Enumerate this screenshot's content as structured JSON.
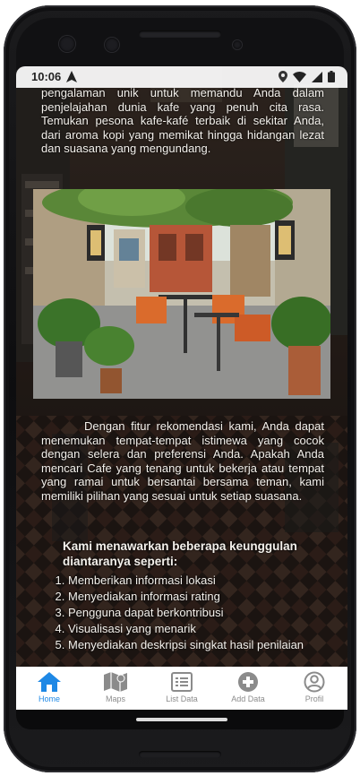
{
  "status_bar": {
    "time": "10:06"
  },
  "content": {
    "paragraph_1": "pengalaman unik untuk memandu Anda dalam penjelajahan dunia kafe yang penuh cita rasa. Temukan pesona kafe-kafé terbaik di sekitar Anda, dari aroma kopi yang memikat hingga hidangan lezat dan suasana yang mengundang.",
    "paragraph_2": "Dengan fitur rekomendasi kami, Anda dapat menemukan tempat-tempat istimewa yang cocok dengan selera dan preferensi Anda. Apakah Anda mencari Cafe yang tenang untuk bekerja atau tempat yang ramai untuk bersantai bersama teman, kami memiliki pilihan yang sesuai untuk setiap suasana.",
    "list_title": "Kami menawarkan beberapa keunggulan diantaranya seperti:",
    "list_items": [
      "Memberikan informasi lokasi",
      "Menyediakan informasi rating",
      "Pengguna dapat berkontribusi",
      "Visualisasi yang menarik",
      "Menyediakan deskripsi singkat hasil penilaian"
    ]
  },
  "nav": {
    "items": [
      {
        "label": "Home",
        "icon": "home-icon",
        "active": true
      },
      {
        "label": "Maps",
        "icon": "map-icon",
        "active": false
      },
      {
        "label": "List Data",
        "icon": "list-icon",
        "active": false
      },
      {
        "label": "Add Data",
        "icon": "add-circle-icon",
        "active": false
      },
      {
        "label": "Profil",
        "icon": "profile-icon",
        "active": false
      }
    ]
  },
  "colors": {
    "accent": "#1e88e5",
    "inactive": "#8b8b8b",
    "text_on_bg": "#f4f1ec"
  }
}
